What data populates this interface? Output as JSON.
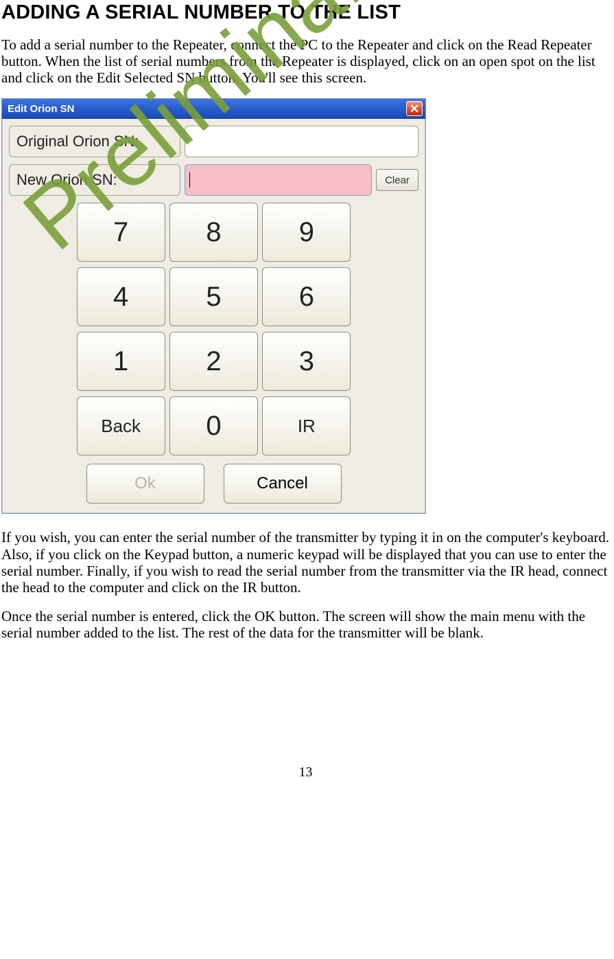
{
  "heading": "ADDING A SERIAL NUMBER TO THE LIST",
  "para1": "To add a serial number to the Repeater, connect the PC to the Repeater and click on the Read Repeater button.  When the list of serial numbers from the Repeater is displayed, click on an open spot on the list and click on the Edit Selected SN button.  You'll see this screen.",
  "dialog": {
    "title": "Edit Orion SN",
    "original_label": "Original Orion SN:",
    "original_value": "",
    "new_label": "New Orion SN:",
    "new_value": "",
    "clear": "Clear",
    "keys": {
      "k7": "7",
      "k8": "8",
      "k9": "9",
      "k4": "4",
      "k5": "5",
      "k6": "6",
      "k1": "1",
      "k2": "2",
      "k3": "3",
      "back": "Back",
      "k0": "0",
      "ir": "IR"
    },
    "ok": "Ok",
    "cancel": "Cancel"
  },
  "watermark": "Preliminary",
  "para2": "If you wish, you can enter the serial number of the transmitter by typing it in on the computer's keyboard.  Also, if you click on the Keypad button, a numeric keypad will be displayed that you can use to enter the serial number.  Finally, if you wish to read the serial number from the transmitter via the IR head, connect the head to the computer and click on the IR button.",
  "para3": "Once the serial number is entered, click the OK button.  The screen will show the main menu with the serial number added to the list.  The rest of the data for the transmitter will be blank.",
  "page_number": "13"
}
